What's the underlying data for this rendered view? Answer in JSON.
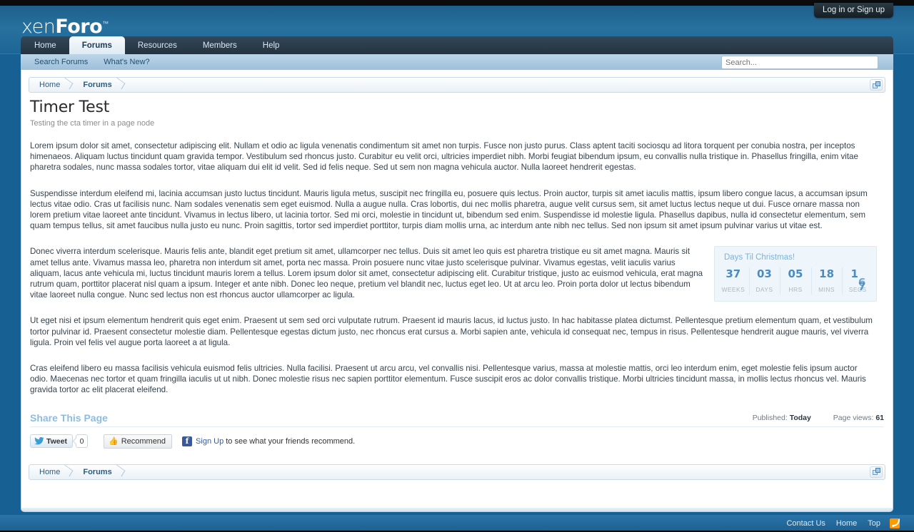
{
  "login": {
    "label": "Log in or Sign up"
  },
  "brand": {
    "pre": "xen",
    "strong": "Foro",
    "tm": "™"
  },
  "nav": {
    "tabs": [
      {
        "label": "Home",
        "selected": false
      },
      {
        "label": "Forums",
        "selected": true
      },
      {
        "label": "Resources",
        "selected": false
      },
      {
        "label": "Members",
        "selected": false
      },
      {
        "label": "Help",
        "selected": false
      }
    ]
  },
  "subnav": {
    "links": [
      {
        "label": "Search Forums"
      },
      {
        "label": "What's New?"
      }
    ]
  },
  "search": {
    "placeholder": "Search..."
  },
  "breadcrumb": {
    "items": [
      {
        "label": "Home"
      },
      {
        "label": "Forums"
      }
    ],
    "jump_icon": "open-quick-navigation-icon"
  },
  "page": {
    "title": "Timer Test",
    "subtitle": "Testing the cta timer in a page node",
    "paragraphs": [
      "Lorem ipsum dolor sit amet, consectetur adipiscing elit. Nullam et odio ac ligula venenatis condimentum sit amet non turpis. Fusce non justo purus. Class aptent taciti sociosqu ad litora torquent per conubia nostra, per inceptos himenaeos. Aliquam luctus tincidunt quam gravida tempor. Vestibulum sed rhoncus justo. Curabitur eu velit orci, ultricies imperdiet nibh. Morbi feugiat bibendum ipsum, eu convallis nulla tristique in. Phasellus fringilla, enim vitae pharetra sodales, nunc massa sodales tortor, vitae aliquam dui elit id velit. Sed id felis neque. Sed ut sem non magna vehicula auctor. Nulla laoreet hendrerit egestas.",
      "Suspendisse interdum eleifend mi, lacinia accumsan justo luctus tincidunt. Mauris ligula metus, suscipit nec fringilla eu, posuere quis lectus. Proin auctor, turpis sit amet iaculis mattis, ipsum libero congue lacus, a accumsan ipsum lectus vitae odio. Cras ut facilisis nunc. Nam sodales venenatis sem eget euismod. Nulla a augue nulla. Cras lobortis, dui nec mollis pharetra, augue velit cursus sem, sit amet luctus lectus neque ut dui. Fusce ornare massa non lorem pretium vitae laoreet ante tincidunt. Vivamus in lectus libero, ut lacinia tortor. Sed mi orci, molestie in tincidunt ut, bibendum sed enim. Suspendisse id molestie ligula. Phasellus dapibus, nulla id consectetur elementum, sem quam tempus tellus, sit amet faucibus nulla justo eu nunc. Proin sagittis, tortor sed imperdiet porttitor, turpis diam mollis urna, ac interdum ante nibh nec tellus. Sed non ipsum sit amet ipsum pulvinar varius ut vitae est.",
      "Donec viverra interdum scelerisque. Mauris felis ante, blandit eget pretium sit amet, ullamcorper nec tellus. Duis sit amet leo quis est pharetra tristique eu sit amet magna. Mauris sit amet tellus ante. Vivamus massa leo, pharetra non interdum sit amet, porta nec massa. Proin posuere nunc vitae justo scelerisque pulvinar. Vivamus egestas, velit iaculis varius aliquam, lacus ante vehicula mi, luctus tincidunt mauris lorem a tellus. Lorem ipsum dolor sit amet, consectetur adipiscing elit. Curabitur tristique, justo ac euismod vehicula, erat magna rutrum quam, porttitor placerat nisl quam a ipsum. Integer et ante nibh. Donec leo neque, pretium vel blandit nec, luctus eget leo. Ut at arcu leo. Proin porta dolor ut lectus bibendum vitae laoreet nulla congue. Nunc sed lectus non est rhoncus auctor ullamcorper ac ligula.",
      "Ut eget nisi et ipsum elementum hendrerit quis eget enim. Praesent ut sem sed orci vulputate rutrum. Praesent id mauris lacus, id luctus justo. In hac habitasse platea dictumst. Pellentesque pretium elementum quam, et vestibulum tortor pulvinar id. Praesent consectetur molestie diam. Pellentesque egestas dictum justo, nec rhoncus erat cursus a. Morbi sapien ante, vehicula id consequat nec, tempus in risus. Pellentesque hendrerit augue mauris, vel viverra ligula. Proin vel felis vel augue porta laoreet a at ligula.",
      "Cras eleifend libero eu massa facilisis vehicula euismod felis ultricies. Nulla facilisi. Praesent ut arcu arcu, vel convallis nisi. Pellentesque varius, massa at molestie mattis, orci leo interdum enim, eget molestie felis ipsum auctor odio. Maecenas nec tortor et quam fringilla iaculis ut ut nibh. Donec molestie risus nec sapien porttitor elementum. Fusce suscipit eros ac dolor convallis tristique. Morbi ultricies tincidunt massa, in mollis lectus rhoncus vel. Mauris gravida tortor ac elit placerat eleifend."
    ]
  },
  "timer": {
    "title": "Days Til Christmas!",
    "units": [
      {
        "value": "37",
        "label": "WEEKS"
      },
      {
        "value": "03",
        "label": "DAYS"
      },
      {
        "value": "05",
        "label": "HRS"
      },
      {
        "value": "18",
        "label": "MINS"
      },
      {
        "value": "17",
        "label": "SECS",
        "flipping": true,
        "flip_from": "6",
        "flip_to": "7",
        "lead": "1"
      }
    ],
    "accent_color": "#4a8cc0",
    "title_color": "#7bb3da",
    "background_color": "#eef6fb"
  },
  "share": {
    "heading": "Share This Page",
    "published_label": "Published:",
    "published_value": "Today",
    "views_label": "Page views:",
    "views_value": "61",
    "tweet_label": "Tweet",
    "tweet_count": "0",
    "fb_recommend_label": "Recommend",
    "fb_signup_label": "Sign Up",
    "fb_signup_rest": " to see what your friends recommend."
  },
  "footer": {
    "links": [
      {
        "label": "Contact Us"
      },
      {
        "label": "Home"
      },
      {
        "label": "Top"
      }
    ],
    "rss_icon": "rss-feed-icon"
  }
}
